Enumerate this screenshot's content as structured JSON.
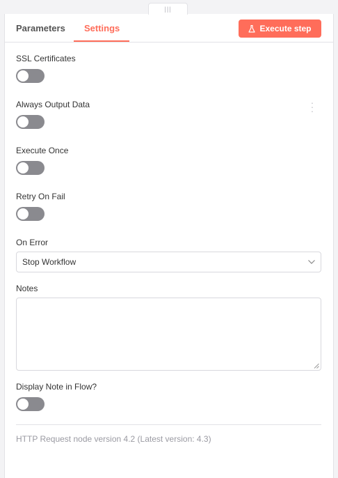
{
  "tabs": [
    {
      "label": "Parameters",
      "active": false
    },
    {
      "label": "Settings",
      "active": true
    }
  ],
  "toolbar": {
    "execute_label": "Execute step",
    "execute_icon": "flask-icon"
  },
  "settings": {
    "ssl_certificates": {
      "label": "SSL Certificates",
      "enabled": false
    },
    "always_output_data": {
      "label": "Always Output Data",
      "enabled": false
    },
    "execute_once": {
      "label": "Execute Once",
      "enabled": false
    },
    "retry_on_fail": {
      "label": "Retry On Fail",
      "enabled": false
    },
    "on_error": {
      "label": "On Error",
      "selected": "Stop Workflow"
    },
    "notes": {
      "label": "Notes",
      "value": ""
    },
    "display_note": {
      "label": "Display Note in Flow?",
      "enabled": false
    }
  },
  "footer": {
    "version_text": "HTTP Request node version 4.2 (Latest version: 4.3)"
  },
  "colors": {
    "accent": "#ff6d5a",
    "toggle_off": "#8a8a8f"
  }
}
